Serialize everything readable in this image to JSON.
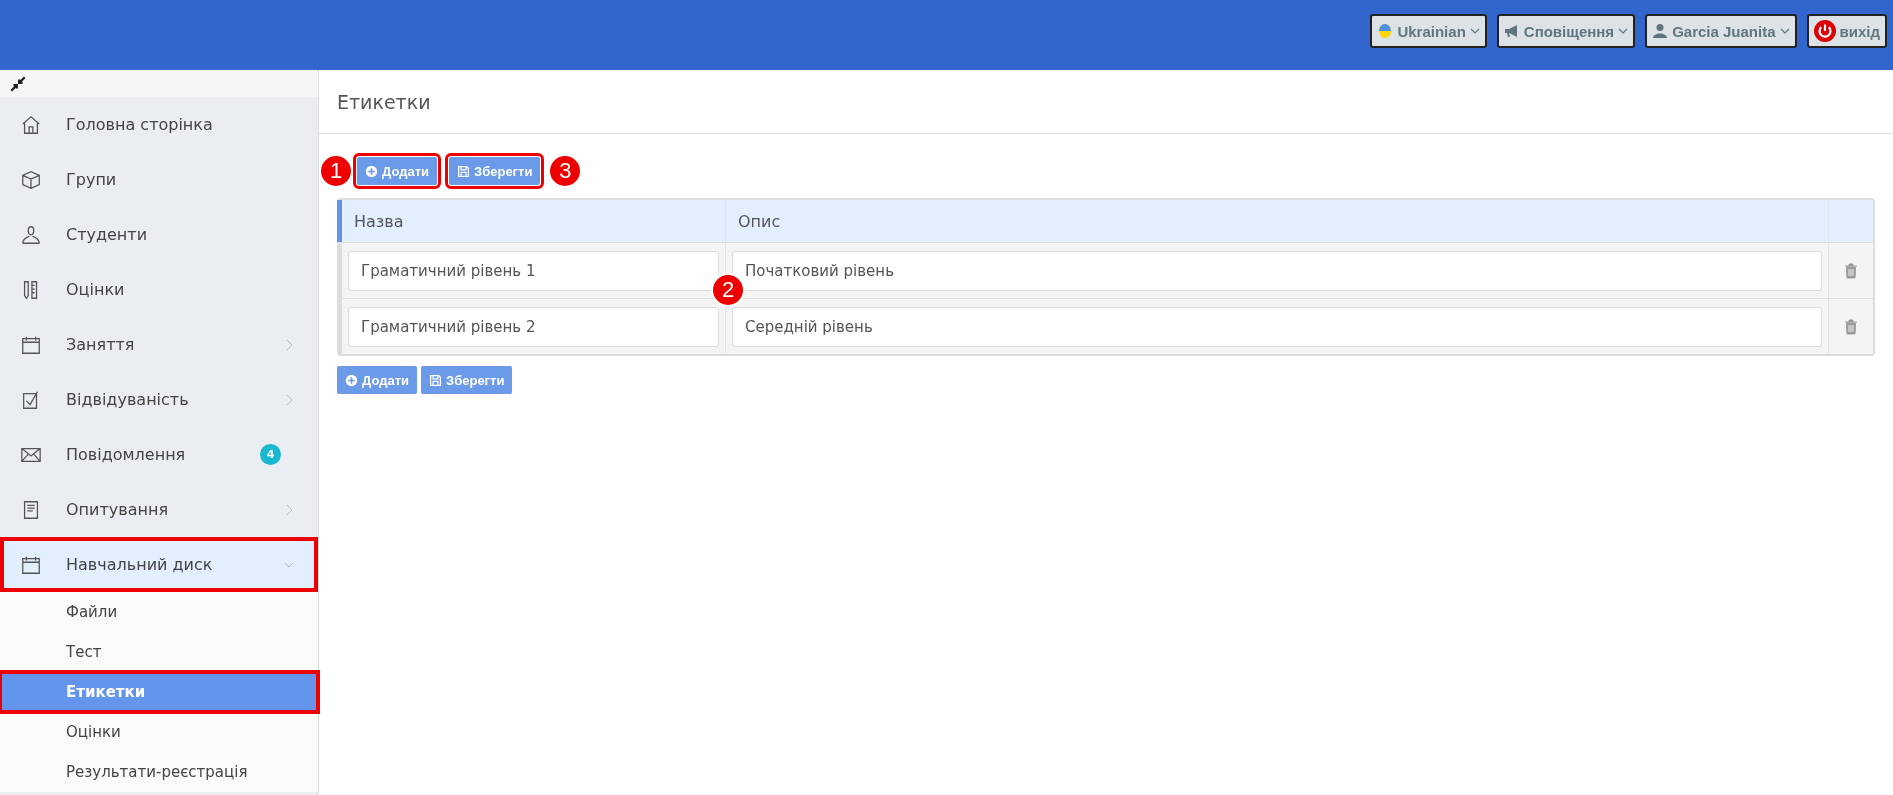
{
  "topbar": {
    "buttons": [
      {
        "kind": "language",
        "label": "Ukrainian"
      },
      {
        "kind": "notifications",
        "label": "Сповіщення"
      },
      {
        "kind": "user",
        "label": "Garcia Juanita"
      },
      {
        "kind": "logout",
        "label": "вихід"
      }
    ]
  },
  "sidebar": {
    "items": [
      {
        "kind": "home",
        "label": "Головна сторінка",
        "has_arrow": false,
        "expanded": false,
        "outlined": false
      },
      {
        "kind": "box",
        "label": "Групи",
        "has_arrow": false,
        "expanded": false,
        "outlined": false
      },
      {
        "kind": "user",
        "label": "Студенти",
        "has_arrow": false,
        "expanded": false,
        "outlined": false
      },
      {
        "kind": "grades",
        "label": "Оцінки",
        "has_arrow": false,
        "expanded": false,
        "outlined": false
      },
      {
        "kind": "calendar",
        "label": "Заняття",
        "has_arrow": true,
        "expanded": false,
        "outlined": false
      },
      {
        "kind": "check",
        "label": "Відвідуваність",
        "has_arrow": true,
        "expanded": false,
        "outlined": false
      },
      {
        "kind": "mail",
        "label": "Повідомлення",
        "has_arrow": false,
        "expanded": false,
        "outlined": false,
        "badge": "4"
      },
      {
        "kind": "survey",
        "label": "Опитування",
        "has_arrow": true,
        "expanded": false,
        "outlined": false
      },
      {
        "kind": "calendar",
        "label": "Навчальний диск",
        "has_arrow": true,
        "expanded": true,
        "outlined": true,
        "children": [
          {
            "label": "Файли",
            "selected": false,
            "outlined": false
          },
          {
            "label": "Тест",
            "selected": false,
            "outlined": false
          },
          {
            "label": "Етикетки",
            "selected": true,
            "outlined": true
          },
          {
            "label": "Оцінки",
            "selected": false,
            "outlined": false
          },
          {
            "label": "Результати-реєстрація",
            "selected": false,
            "outlined": false
          }
        ]
      }
    ]
  },
  "page": {
    "title": "Етикетки",
    "top_buttons": [
      {
        "kind": "add",
        "label": "Додати",
        "outlined": true,
        "callout": "1"
      },
      {
        "kind": "save",
        "label": "Зберегти",
        "outlined": true,
        "callout": "3"
      }
    ],
    "table": {
      "columns": [
        "Назва",
        "Опис"
      ],
      "rows": [
        {
          "name": "Граматичний рівень 1",
          "description": "Початковий рівень"
        },
        {
          "name": "Граматичний рівень 2",
          "description": "Середній рівень"
        }
      ],
      "callout": "2"
    },
    "bottom_buttons": [
      {
        "kind": "add",
        "label": "Додати",
        "outlined": false
      },
      {
        "kind": "save",
        "label": "Зберегти",
        "outlined": false
      }
    ]
  }
}
